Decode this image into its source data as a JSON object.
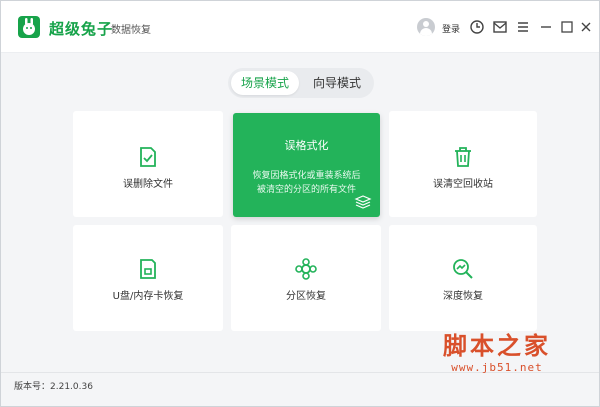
{
  "app": {
    "title": "超级兔子",
    "subtitle": "数据恢复",
    "login_label": "登录"
  },
  "toolbar_icons": [
    "avatar-icon",
    "refresh-settings-icon",
    "message-icon",
    "menu-icon",
    "minimize-icon",
    "close-icon"
  ],
  "tabs": [
    {
      "label": "场景模式",
      "active": true
    },
    {
      "label": "向导模式",
      "active": false
    }
  ],
  "cards": [
    {
      "label": "误删除文件",
      "icon": "delete-file-icon"
    },
    {
      "title": "误格式化",
      "desc_line1": "恢复因格式化或重装系统后",
      "desc_line2": "被清空的分区的所有文件",
      "icon": "layers-icon"
    },
    {
      "label": "误清空回收站",
      "icon": "recycle-bin-icon"
    },
    {
      "label": "U盘/内存卡恢复",
      "icon": "sd-card-icon"
    },
    {
      "label": "分区恢复",
      "icon": "partition-icon"
    },
    {
      "label": "深度恢复",
      "icon": "deep-scan-icon"
    }
  ],
  "footer": {
    "version": "版本号：2.21.0.36"
  },
  "watermark": {
    "text": "脚本之家",
    "url": "www.jb51.net"
  },
  "colors": {
    "accent": "#23b35a",
    "brand": "#17a34a",
    "watermark": "#d9502b"
  }
}
